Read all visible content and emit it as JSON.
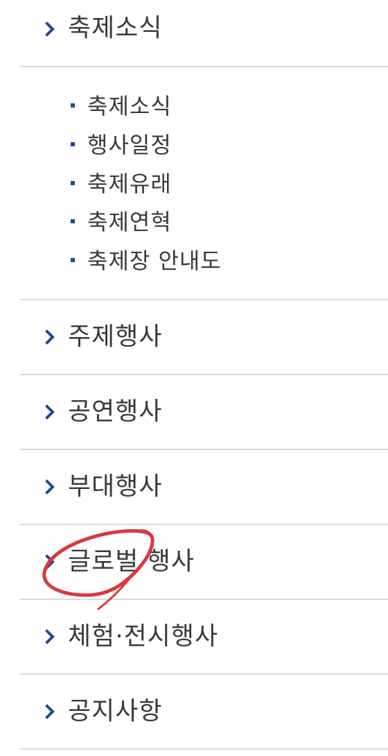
{
  "menu": {
    "items": [
      {
        "label": "축제소식",
        "icon": "chevron-right-icon",
        "expanded": true
      },
      {
        "label": "주제행사",
        "icon": "chevron-right-icon"
      },
      {
        "label": "공연행사",
        "icon": "chevron-right-icon"
      },
      {
        "label": "부대행사",
        "icon": "chevron-right-icon"
      },
      {
        "label": "글로벌 행사",
        "icon": "chevron-right-icon"
      },
      {
        "label": "체험·전시행사",
        "icon": "chevron-right-icon"
      },
      {
        "label": "공지사항",
        "icon": "chevron-right-icon"
      }
    ],
    "submenu": [
      {
        "label": "축제소식"
      },
      {
        "label": "행사일정"
      },
      {
        "label": "축제유래"
      },
      {
        "label": "축제연혁"
      },
      {
        "label": "축제장 안내도"
      }
    ]
  },
  "annotation": {
    "type": "hand-drawn-circle",
    "color": "#d9383e",
    "target": "글로벌 행사"
  },
  "colors": {
    "accent": "#1e4a8c",
    "text": "#3a3a3a",
    "divider": "#d9d9d9"
  }
}
